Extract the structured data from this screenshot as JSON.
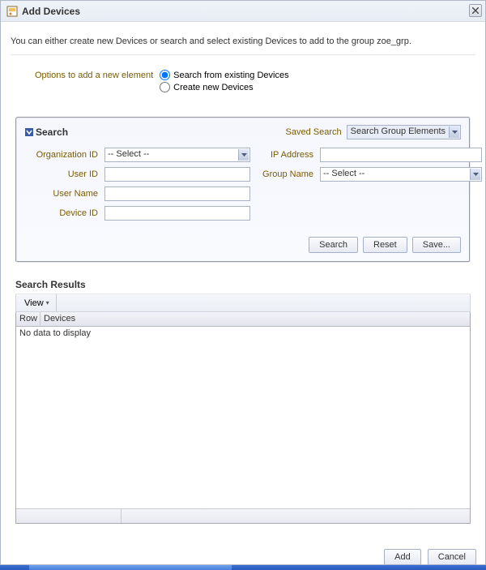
{
  "dialog": {
    "title": "Add Devices",
    "instruction": "You can either create new Devices or search and select existing Devices to add to the group zoe_grp."
  },
  "options": {
    "label": "Options to add a new element",
    "radio1": "Search from existing Devices",
    "radio2": "Create new Devices",
    "selected": "search"
  },
  "search_panel": {
    "title": "Search",
    "saved_search_label": "Saved Search",
    "saved_search_value": "Search Group Elements",
    "fields": {
      "organization_id": {
        "label": "Organization ID",
        "value": "-- Select --"
      },
      "user_id": {
        "label": "User ID",
        "value": ""
      },
      "user_name": {
        "label": "User Name",
        "value": ""
      },
      "device_id": {
        "label": "Device ID",
        "value": ""
      },
      "ip_address": {
        "label": "IP Address",
        "value": ""
      },
      "group_name": {
        "label": "Group Name",
        "value": "-- Select --"
      }
    },
    "buttons": {
      "search": "Search",
      "reset": "Reset",
      "save": "Save..."
    }
  },
  "results": {
    "title": "Search Results",
    "view_menu": "View",
    "col_row": "Row",
    "col_devices": "Devices",
    "no_data": "No data to display"
  },
  "footer": {
    "add": "Add",
    "cancel": "Cancel"
  }
}
